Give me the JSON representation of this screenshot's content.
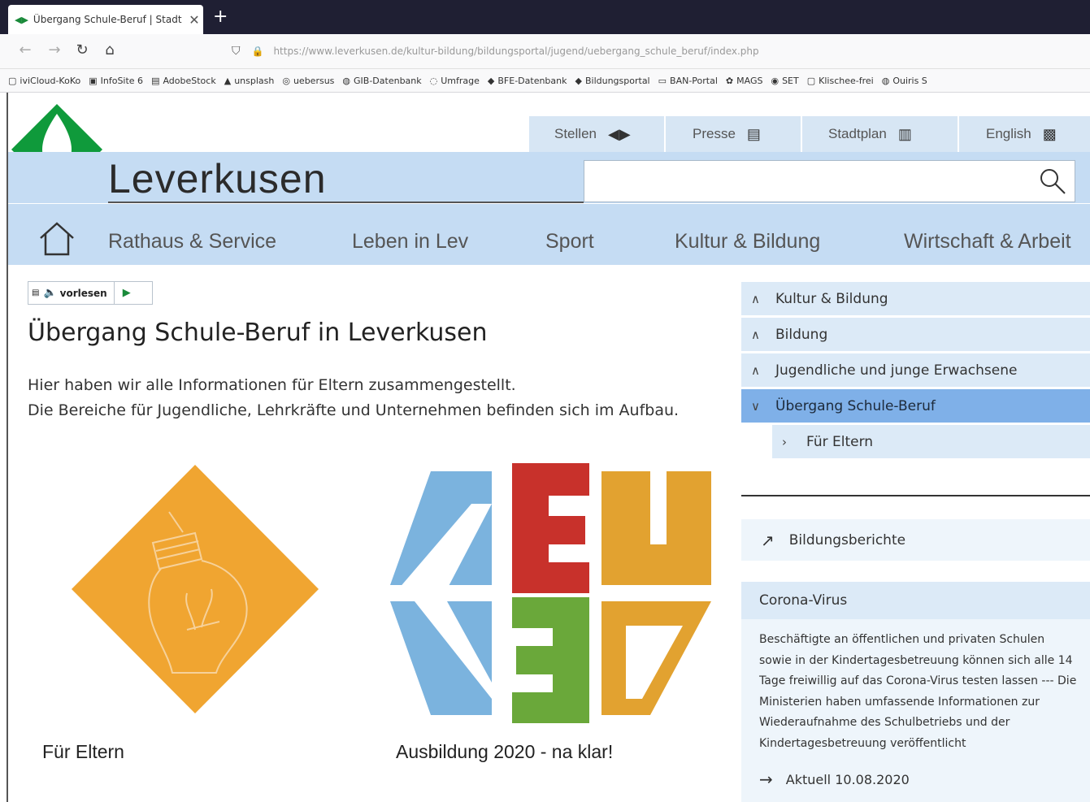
{
  "browser": {
    "tab_title": "Übergang Schule-Beruf | Stadt",
    "tab_close": "✕",
    "new_tab": "+",
    "url": "https://www.leverkusen.de/kultur-bildung/bildungsportal/jugend/uebergang_schule_beruf/index.php",
    "bookmarks": [
      "iviCloud-KoKo",
      "InfoSite 6",
      "AdobeStock",
      "unsplash",
      "uebersus",
      "GIB-Datenbank",
      "Umfrage",
      "BFE-Datenbank",
      "Bildungsportal",
      "BAN-Portal",
      "MAGS",
      "SET",
      "Klischee-frei",
      "Ouiris S"
    ]
  },
  "header": {
    "toplinks": [
      {
        "label": "Stellen",
        "icon": "◆"
      },
      {
        "label": "Presse",
        "icon": "▤"
      },
      {
        "label": "Stadtplan",
        "icon": "▥"
      },
      {
        "label": "English",
        "icon": "▩"
      }
    ],
    "brand": "Leverkusen",
    "search_placeholder": ""
  },
  "mainnav": [
    "Rathaus & Service",
    "Leben in Lev",
    "Sport",
    "Kultur & Bildung",
    "Wirtschaft & Arbeit"
  ],
  "content": {
    "vorlesen": "vorlesen",
    "title": "Übergang Schule-Beruf in Leverkusen",
    "intro_1": "Hier haben wir alle Informationen für Eltern zusammengestellt.",
    "intro_2": "Die Bereiche für Jugendliche, Lehrkräfte und Unternehmen befinden sich im Aufbau.",
    "tiles": [
      {
        "label": "Für Eltern"
      },
      {
        "label": "Ausbildung 2020 - na klar!"
      }
    ]
  },
  "sidebar": {
    "nav": [
      {
        "label": "Kultur & Bildung",
        "chevron": "∧"
      },
      {
        "label": "Bildung",
        "chevron": "∧"
      },
      {
        "label": "Jugendliche und junge Erwachsene",
        "chevron": "∧"
      },
      {
        "label": "Übergang Schule-Beruf",
        "chevron": "∨"
      },
      {
        "label": "Für Eltern",
        "chevron": "›"
      }
    ],
    "link": "Bildungsberichte",
    "corona_title": "Corona-Virus",
    "corona_text": "Beschäftigte an öffentlichen und privaten Schulen sowie in der Kindertagesbetreuung können sich alle 14 Tage freiwillig auf das Corona-Virus testen lassen --- Die Ministerien haben umfassende Informationen zur Wiederaufnahme des Schulbetriebs und der Kindertagesbetreuung veröffentlicht",
    "aktuell": "Aktuell 10.08.2020"
  },
  "colors": {
    "brand_green": "#0f9a3b",
    "nav_blue": "#c5dcf3",
    "active_blue": "#7fb0e8",
    "tile_orange": "#f0a531"
  }
}
